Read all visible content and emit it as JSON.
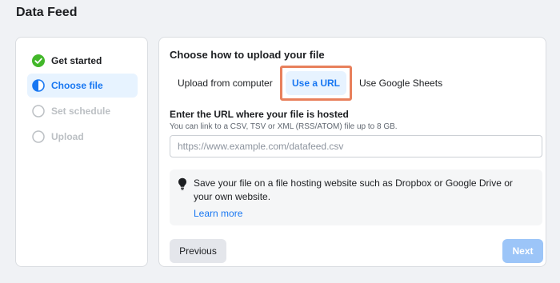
{
  "page": {
    "title": "Data Feed"
  },
  "steps": [
    {
      "label": "Get started",
      "state": "done",
      "icon": "check-circle-icon"
    },
    {
      "label": "Choose file",
      "state": "current",
      "icon": "half-circle-icon"
    },
    {
      "label": "Set schedule",
      "state": "pending",
      "icon": "empty-circle-icon"
    },
    {
      "label": "Upload",
      "state": "pending",
      "icon": "empty-circle-icon"
    }
  ],
  "upload": {
    "title": "Choose how to upload your file",
    "tabs": [
      {
        "label": "Upload from computer",
        "selected": false
      },
      {
        "label": "Use a URL",
        "selected": true
      },
      {
        "label": "Use Google Sheets",
        "selected": false
      }
    ],
    "url_label": "Enter the URL where your file is hosted",
    "url_hint": "You can link to a CSV, TSV or XML (RSS/ATOM) file up to 8 GB.",
    "url_placeholder": "https://www.example.com/datafeed.csv",
    "url_value": "",
    "info_text": "Save your file on a file hosting website such as Dropbox or Google Drive or your own website.",
    "learn_more": "Learn more"
  },
  "buttons": {
    "previous": "Previous",
    "next": "Next"
  },
  "colors": {
    "accent": "#1877f2",
    "success": "#42b72a",
    "highlight": "#e8805c",
    "next_disabled": "#9cc5f8"
  }
}
